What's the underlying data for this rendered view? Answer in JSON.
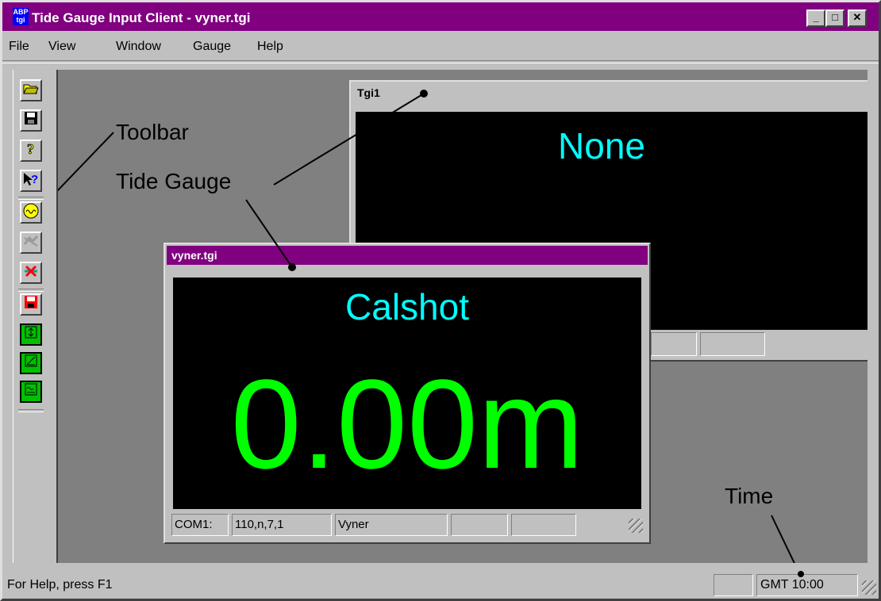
{
  "app": {
    "title": "Tide Gauge Input Client - vyner.tgi",
    "icon_top": "ABP",
    "icon_bottom": "tgi"
  },
  "window_controls": {
    "minimize": "_",
    "maximize": "□",
    "close": "✕"
  },
  "menu": [
    "File",
    "View",
    "Window",
    "Gauge",
    "Help"
  ],
  "toolbar": {
    "buttons": [
      {
        "name": "open-icon"
      },
      {
        "name": "save-icon"
      },
      {
        "name": "about-icon"
      },
      {
        "name": "context-help-icon"
      },
      {
        "name": "gauge-connect-icon"
      },
      {
        "name": "gauge-disabled-icon"
      },
      {
        "name": "disconnect-icon"
      },
      {
        "name": "record-save-icon"
      },
      {
        "name": "view-level-icon"
      },
      {
        "name": "view-graph-icon"
      },
      {
        "name": "view-wave-icon"
      }
    ]
  },
  "annotations": {
    "toolbar": "Toolbar",
    "tide_gauge": "Tide Gauge",
    "time": "Time"
  },
  "tgi1": {
    "title": "Tgi1",
    "station": "None"
  },
  "vyner": {
    "title": "vyner.tgi",
    "station": "Calshot",
    "level": "0.00m",
    "status": [
      "COM1:",
      "110,n,7,1",
      "Vyner",
      "",
      ""
    ]
  },
  "statusbar": {
    "help": "For Help, press F1",
    "time": "GMT 10:00"
  },
  "colors": {
    "title_bar": "#800080",
    "station_text": "#00ffff",
    "level_text": "#00ff00",
    "screen_bg": "#000000"
  }
}
